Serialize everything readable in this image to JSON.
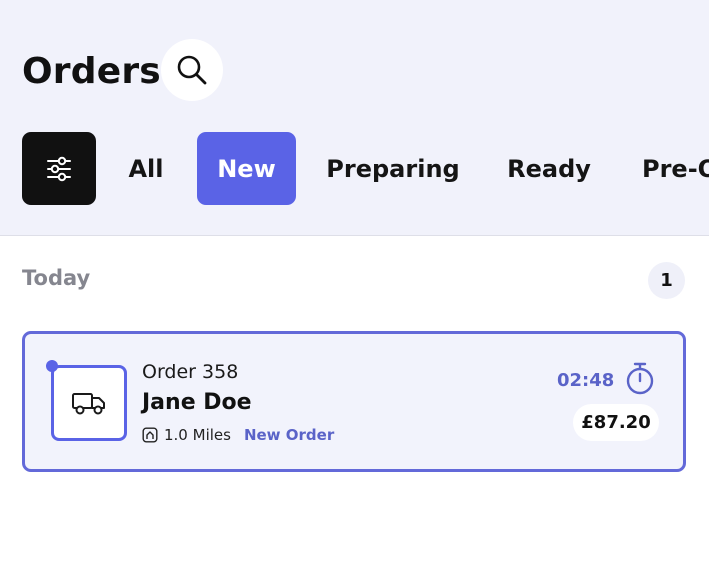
{
  "header": {
    "title": "Orders",
    "search_icon": "search-icon",
    "filter_icon": "sliders-icon"
  },
  "tabs": [
    {
      "label": "All",
      "active": false
    },
    {
      "label": "New",
      "active": true
    },
    {
      "label": "Preparing",
      "active": false
    },
    {
      "label": "Ready",
      "active": false
    },
    {
      "label": "Pre-O",
      "active": false
    }
  ],
  "section": {
    "label": "Today",
    "count": "1"
  },
  "orders": [
    {
      "order_number": "Order 358",
      "customer": "Jane Doe",
      "distance": "1.0 Miles",
      "status": "New Order",
      "timer": "02:48",
      "price": "£87.20",
      "vehicle_icon": "truck-icon",
      "distance_icon": "route-icon",
      "timer_icon": "stopwatch-icon"
    }
  ],
  "colors": {
    "accent": "#5a63e6",
    "header_bg": "#f1f2fb",
    "card_bg": "#f2f3fc",
    "filter_bg": "#111111"
  }
}
